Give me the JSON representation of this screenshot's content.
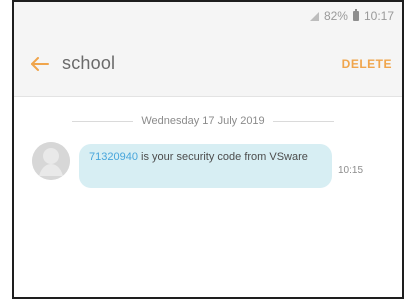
{
  "statusbar": {
    "battery_percent": "82%",
    "time": "10:17"
  },
  "header": {
    "title": "school",
    "delete_label": "DELETE"
  },
  "conversation": {
    "date": "Wednesday 17 July 2019",
    "messages": [
      {
        "code": "71320940",
        "text_after_code": " is your security code from VSware",
        "time": "10:15"
      }
    ]
  },
  "colors": {
    "accent": "#f0a54c",
    "bubble_background": "#d7eef3",
    "link": "#47a5db"
  }
}
